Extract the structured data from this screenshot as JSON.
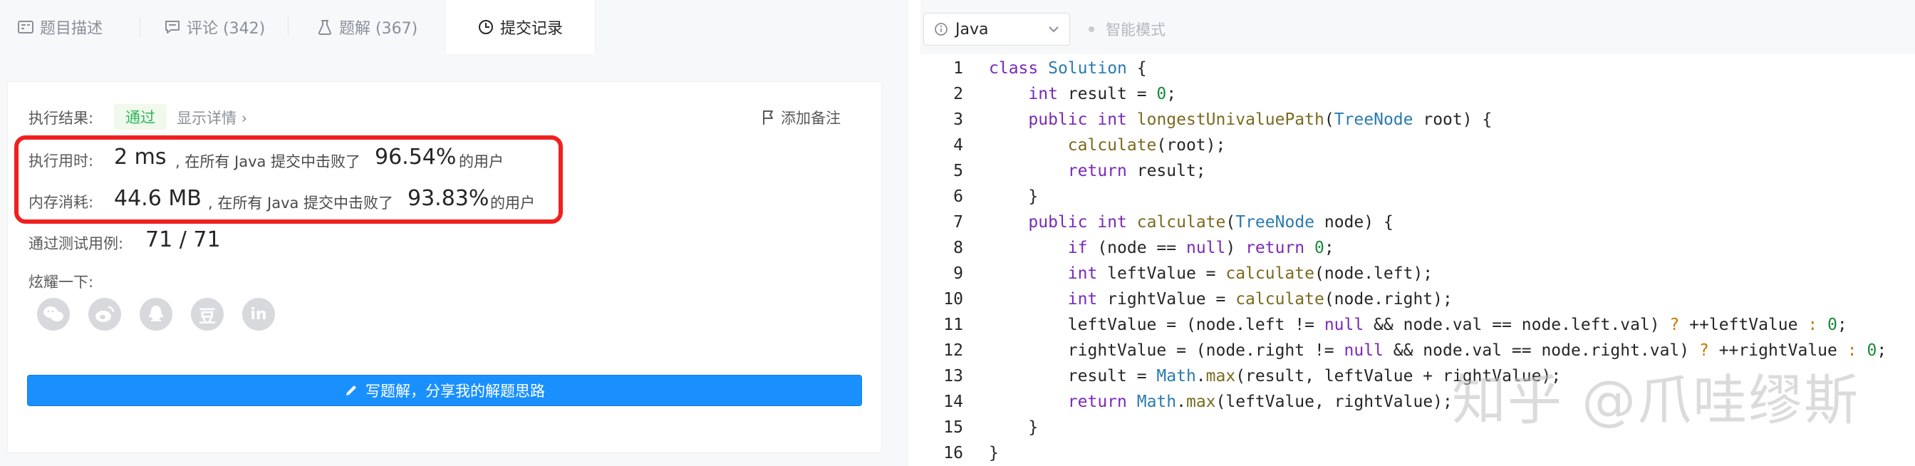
{
  "tabs": [
    {
      "label": "题目描述",
      "icon": "description-icon"
    },
    {
      "label": "评论 (342)",
      "icon": "comment-icon"
    },
    {
      "label": "题解 (367)",
      "icon": "flask-icon"
    },
    {
      "label": "提交记录",
      "icon": "clock-icon"
    }
  ],
  "result": {
    "label": "执行结果:",
    "status": "通过",
    "details_link": "显示详情 ›",
    "add_note": "添加备注",
    "runtime_label": "执行用时:",
    "runtime_value": "2 ms",
    "runtime_text": ", 在所有 Java 提交中击败了",
    "runtime_percent": "96.54%",
    "runtime_suffix": "的用户",
    "memory_label": "内存消耗:",
    "memory_value": "44.6 MB",
    "memory_text": ", 在所有 Java 提交中击败了",
    "memory_percent": "93.83%",
    "memory_suffix": "的用户",
    "tests_label": "通过测试用例:",
    "tests_value": "71 / 71",
    "share_label": "炫耀一下:",
    "social_icons": [
      "wechat-icon",
      "weibo-icon",
      "qq-icon",
      "douban-icon",
      "linkedin-icon"
    ],
    "douban_glyph": "豆",
    "linkedin_glyph": "in",
    "write_button": "写题解，分享我的解题思路"
  },
  "editor": {
    "language": "Java",
    "smart_mode": "智能模式",
    "line_numbers": [
      "1",
      "2",
      "3",
      "4",
      "5",
      "6",
      "7",
      "8",
      "9",
      "10",
      "11",
      "12",
      "13",
      "14",
      "15",
      "16"
    ]
  },
  "watermark": "知乎 @爪哇缪斯",
  "colors": {
    "accent_blue": "#1a90ff",
    "pass_green": "#2db55d",
    "highlight_red": "#f02020"
  }
}
